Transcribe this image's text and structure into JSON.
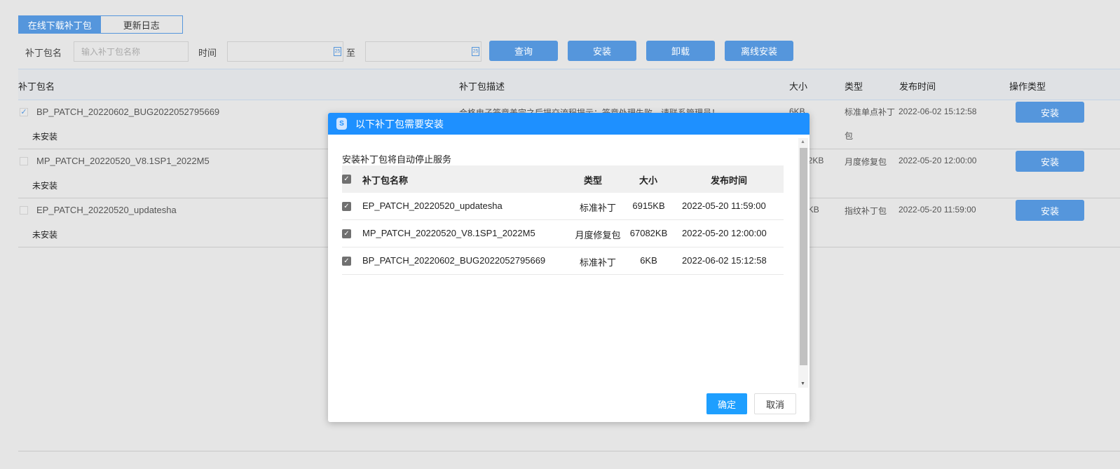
{
  "tabs": [
    {
      "label": "在线下载补丁包",
      "active": true
    },
    {
      "label": "更新日志",
      "active": false
    }
  ],
  "filters": {
    "name_label": "补丁包名",
    "name_placeholder": "输入补丁包名称",
    "time_label": "时间",
    "to_label": "至",
    "calendar_icon": "calendar-icon",
    "calendar_text": "25"
  },
  "toolbar": {
    "query": "查询",
    "install": "安装",
    "uninstall": "卸载",
    "offline_install": "离线安装"
  },
  "table": {
    "headers": [
      "补丁包名",
      "补丁包描述",
      "大小",
      "类型",
      "发布时间",
      "操作类型"
    ],
    "rows": [
      {
        "name": "BP_PATCH_20220602_BUG2022052795669",
        "checked": true,
        "status": "未安装",
        "description": "合格电子签章盖完之后提交流程提示：签章处理失败，请联系管理员！",
        "size": "6KB",
        "type": "标准单点补丁包",
        "date": "2022-06-02 15:12:58",
        "action": "安装"
      },
      {
        "name": "MP_PATCH_20220520_V8.1SP1_2022M5",
        "checked": false,
        "status": "未安装",
        "size": "67082KB",
        "type": "月度修复包",
        "date": "2022-05-20 12:00:00",
        "action": "安装"
      },
      {
        "name": "EP_PATCH_20220520_updatesha",
        "checked": false,
        "status": "未安装",
        "size": "6915KB",
        "type": "指纹补丁包",
        "date": "2022-05-20 11:59:00",
        "action": "安装"
      }
    ]
  },
  "dialog": {
    "title": "以下补丁包需要安装",
    "icon": "shield-s-icon",
    "icon_text": "S",
    "notice": "安装补丁包将自动停止服务",
    "headers": [
      "补丁包名称",
      "类型",
      "大小",
      "发布时间"
    ],
    "rows": [
      {
        "name": "EP_PATCH_20220520_updatesha",
        "type": "标准补丁",
        "size": "6915KB",
        "date": "2022-05-20 11:59:00",
        "checked": true
      },
      {
        "name": "MP_PATCH_20220520_V8.1SP1_2022M5",
        "type": "月度修复包",
        "size": "67082KB",
        "date": "2022-05-20 12:00:00",
        "checked": true
      },
      {
        "name": "BP_PATCH_20220602_BUG2022052795669",
        "type": "标准补丁",
        "size": "6KB",
        "date": "2022-06-02 15:12:58",
        "checked": true
      }
    ],
    "confirm": "确定",
    "cancel": "取消"
  },
  "colors": {
    "accent": "#5596dc",
    "dialog_header": "#1e90ff",
    "confirm": "#1e9fff"
  }
}
